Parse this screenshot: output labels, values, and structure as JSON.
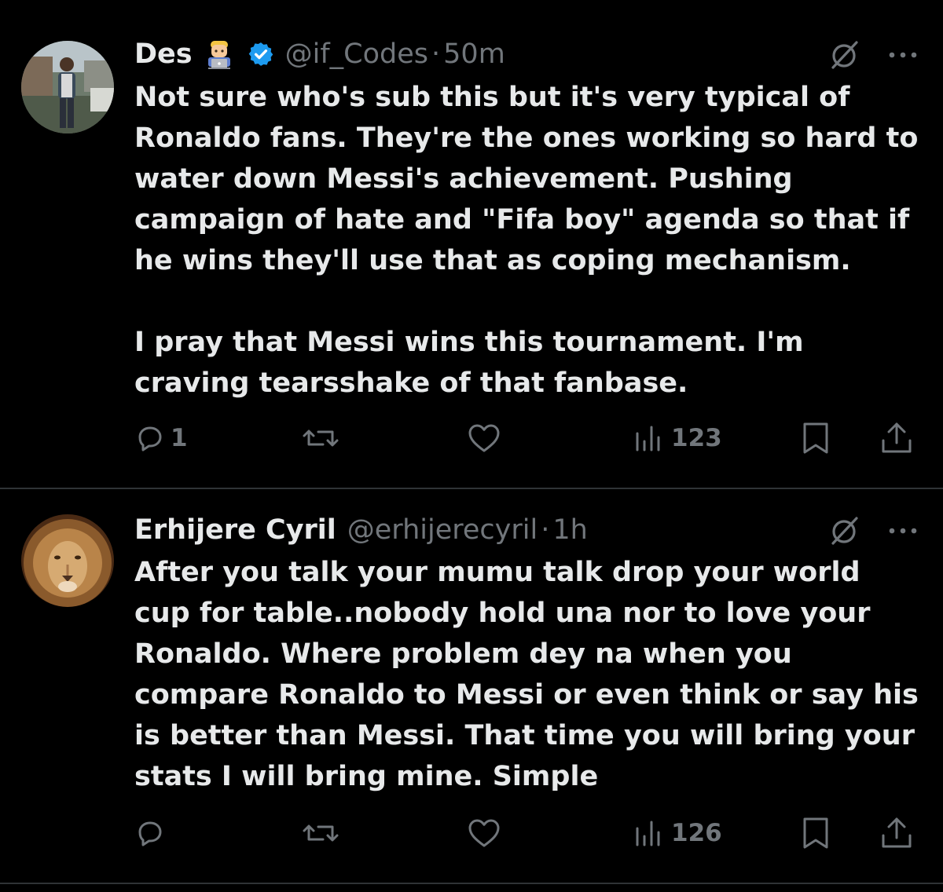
{
  "tweets": [
    {
      "name": "Des",
      "emoji": "technologist-emoji",
      "verified": true,
      "handle": "@if_Codes",
      "separator": "·",
      "time": "50m",
      "text": "Not sure who's sub this but it's very typical of\nRonaldo fans. They're the ones working so hard to\nwater down Messi's achievement. Pushing\ncampaign of hate and \"Fifa boy\" agenda so that if\nhe wins they'll use that as coping mechanism.\n\nI pray that Messi wins this tournament. I'm\ncraving tearsshake of that fanbase.",
      "reply_count": "1",
      "retweet_count": "",
      "like_count": "",
      "views": "123"
    },
    {
      "name": "Erhijere Cyril",
      "verified": false,
      "handle": "@erhijerecyril",
      "separator": "·",
      "time": "1h",
      "text": "After you talk your mumu talk drop your world\ncup for table..nobody hold una nor to love your\nRonaldo. Where problem dey na when you\ncompare Ronaldo to Messi or even think or say his\nis better than Messi. That time you will bring your\nstats I will bring mine. Simple",
      "reply_count": "",
      "retweet_count": "",
      "like_count": "",
      "views": "126"
    }
  ],
  "icons": {
    "reply": "reply-icon",
    "retweet": "retweet-icon",
    "like": "like-icon",
    "views": "views-icon",
    "bookmark": "bookmark-icon",
    "share": "share-icon",
    "grok": "grok-icon",
    "more": "more-icon"
  },
  "colors": {
    "background": "#000000",
    "text": "#e7e9ea",
    "muted": "#71767b",
    "divider": "#2f3336",
    "verified": "#1d9bf0"
  }
}
